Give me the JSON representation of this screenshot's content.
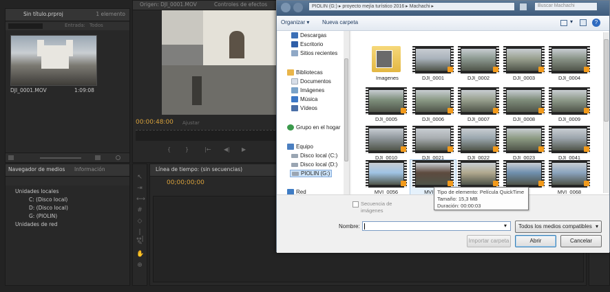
{
  "project": {
    "title": "Sin título.prproj",
    "count": "1 elemento",
    "entrada_label": "Entrada:",
    "entrada_value": "Todos",
    "clip_name": "DJI_0001.MOV",
    "clip_duration": "1:09:08"
  },
  "source_monitor": {
    "tab_origin": "Origen: DJI_0001.MOV",
    "tab_effects": "Controles de efectos",
    "timecode": "00:00:48:00",
    "fit_label": "Ajustar"
  },
  "media_browser": {
    "tab_label": "Navegador de medios",
    "tab_info": "Información",
    "tree": [
      "Unidades locales",
      "C: (Disco local)",
      "D: (Disco local)",
      "G: (PIOLIN)",
      "Unidades de red"
    ]
  },
  "timeline": {
    "tab_label": "Línea de tiempo: (sin secuencias)",
    "timecode": "00;00;00;00"
  },
  "dialog": {
    "address_path": "PIOLIN (G:) ▸ proyecto mejía turístico 2016 ▸ Machachi ▸",
    "search_placeholder": "Buscar Machachi",
    "organizar_label": "Organizar",
    "nueva_carpeta_label": "Nueva carpeta",
    "nav_items": [
      {
        "label": "Descargas",
        "icon": "downloads-folder-icon",
        "color": "#3b6fb6"
      },
      {
        "label": "Escritorio",
        "icon": "desktop-icon",
        "color": "#2f5fa8"
      },
      {
        "label": "Sitios recientes",
        "icon": "recent-places-icon",
        "color": "#8fa8c6"
      },
      {
        "label": "Bibliotecas",
        "icon": "libraries-icon",
        "color": "#e9b54a"
      },
      {
        "label": "Documentos",
        "icon": "documents-icon",
        "color": "#d7dee8"
      },
      {
        "label": "Imágenes",
        "icon": "pictures-icon",
        "color": "#7aa3c9"
      },
      {
        "label": "Música",
        "icon": "music-icon",
        "color": "#3c78c7"
      },
      {
        "label": "Vídeos",
        "icon": "videos-icon",
        "color": "#4a6fa8"
      },
      {
        "label": "Grupo en el hogar",
        "icon": "homegroup-icon",
        "color": "#3b9a4c"
      },
      {
        "label": "Equipo",
        "icon": "computer-icon",
        "color": "#4b7fc0"
      },
      {
        "label": "Disco local (C:)",
        "icon": "drive-c-icon",
        "color": "#9aa5b2"
      },
      {
        "label": "Disco local (D:)",
        "icon": "drive-d-icon",
        "color": "#9aa5b2"
      },
      {
        "label": "PIOLIN (G:)",
        "icon": "usb-drive-icon",
        "color": "#9aa5b2"
      },
      {
        "label": "Red",
        "icon": "network-icon",
        "color": "#3f7cc4"
      }
    ],
    "files": [
      {
        "label": "Imagenes",
        "kind": "folder"
      },
      {
        "label": "DJI_0001",
        "kind": "video",
        "tone": "#a9b2bb"
      },
      {
        "label": "DJI_0002",
        "kind": "video",
        "tone": "#8c9990"
      },
      {
        "label": "DJI_0003",
        "kind": "video",
        "tone": "#99a08f"
      },
      {
        "label": "DJI_0004",
        "kind": "video",
        "tone": "#8a9488"
      },
      {
        "label": "DJI_0005",
        "kind": "video",
        "tone": "#7e8f7c"
      },
      {
        "label": "DJI_0006",
        "kind": "video",
        "tone": "#8b9a86"
      },
      {
        "label": "DJI_0007",
        "kind": "video",
        "tone": "#98a08e"
      },
      {
        "label": "DJI_0008",
        "kind": "video",
        "tone": "#7f8d7b"
      },
      {
        "label": "DJI_0009",
        "kind": "video",
        "tone": "#8e9a8a"
      },
      {
        "label": "DJI_0010",
        "kind": "video",
        "tone": "#8f969b"
      },
      {
        "label": "DJI_0021",
        "kind": "video",
        "tone": "#a8adb0"
      },
      {
        "label": "DJI_0022",
        "kind": "video",
        "tone": "#9aa6ad"
      },
      {
        "label": "DJI_0023",
        "kind": "video",
        "tone": "#8c9a82"
      },
      {
        "label": "DJI_0041",
        "kind": "video",
        "tone": "#9ba4ab"
      },
      {
        "label": "MVI_0056",
        "kind": "video",
        "tone": "#9fc3e4"
      },
      {
        "label": "MVI_00",
        "kind": "video",
        "tone": "#5d4a3e"
      },
      {
        "label": "",
        "kind": "video",
        "tone": "#b0a88e"
      },
      {
        "label": "67",
        "kind": "video",
        "tone": "#6f8fae"
      },
      {
        "label": "MVI_0068",
        "kind": "video",
        "tone": "#8aa3bd"
      }
    ],
    "tooltip_type": "Tipo de elemento: Película QuickTime",
    "tooltip_size": "Tamaño: 15,3 MB",
    "tooltip_duration": "Duración: 00:00:03",
    "sequence_checkbox": "Secuencia de imágenes",
    "name_label": "Nombre:",
    "name_value": "",
    "filter_value": "Todos los medios compatibles",
    "import_folder_label": "Importar carpeta",
    "open_label": "Abrir",
    "cancel_label": "Cancelar"
  }
}
